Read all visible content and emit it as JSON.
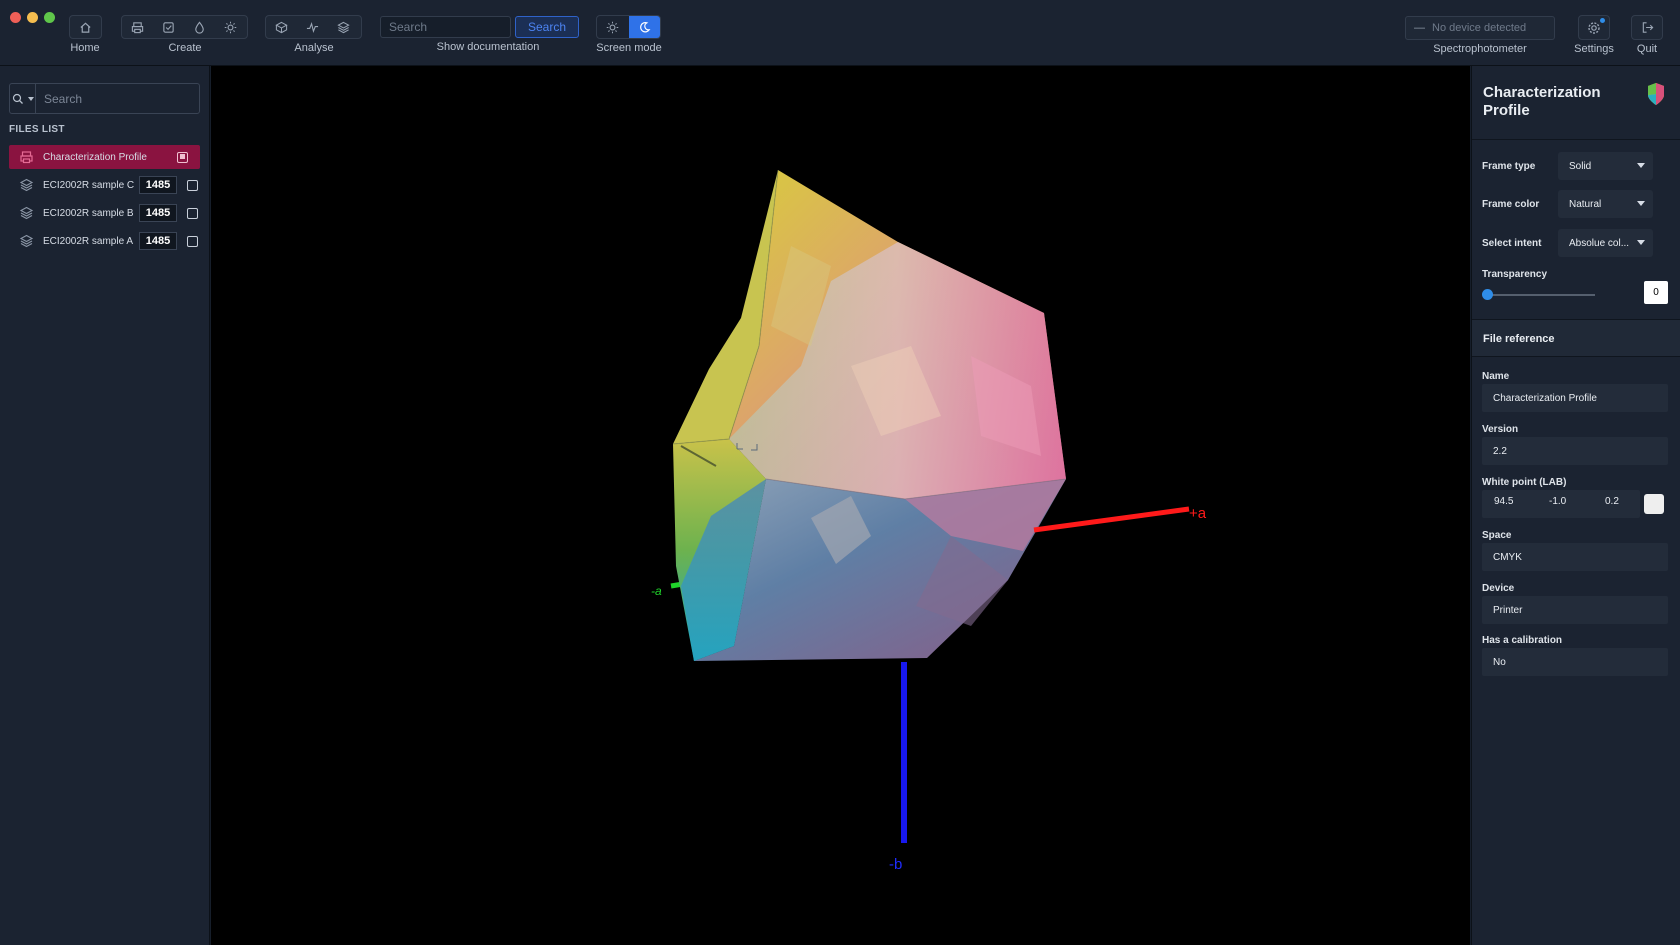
{
  "toolbar": {
    "home_label": "Home",
    "create_label": "Create",
    "analyse_label": "Analyse",
    "search_placeholder": "Search",
    "search_button": "Search",
    "show_documentation": "Show documentation",
    "screen_mode_label": "Screen mode",
    "device_status": "No device detected",
    "spectrophotometer_label": "Spectrophotometer",
    "settings_label": "Settings",
    "quit_label": "Quit"
  },
  "sidebar": {
    "search_placeholder": "Search",
    "files_title": "FILES LIST",
    "files": [
      {
        "name": "Characterization Profile",
        "count": "",
        "selected": true
      },
      {
        "name": "ECI2002R sample C",
        "count": "1485",
        "selected": false
      },
      {
        "name": "ECI2002R sample B",
        "count": "1485",
        "selected": false
      },
      {
        "name": "ECI2002R sample A",
        "count": "1485",
        "selected": false
      }
    ]
  },
  "viewport": {
    "axis_plus_a": "+a",
    "axis_minus_a": "-a",
    "axis_minus_b": "-b"
  },
  "panel": {
    "title": "Characterization Profile",
    "frame_type_label": "Frame type",
    "frame_type_value": "Solid",
    "frame_color_label": "Frame color",
    "frame_color_value": "Natural",
    "select_intent_label": "Select intent",
    "select_intent_value": "Absolue col...",
    "transparency_label": "Transparency",
    "transparency_value": "0",
    "file_reference_title": "File reference",
    "name_label": "Name",
    "name_value": "Characterization Profile",
    "version_label": "Version",
    "version_value": "2.2",
    "white_point_label": "White point (LAB)",
    "white_point_l": "94.5",
    "white_point_a": "-1.0",
    "white_point_b": "0.2",
    "space_label": "Space",
    "space_value": "CMYK",
    "device_label": "Device",
    "device_value": "Printer",
    "calibration_label": "Has a calibration",
    "calibration_value": "No"
  },
  "colors": {
    "accent": "#2f72e8",
    "selected_row": "#8a1340",
    "background": "#161e2a"
  }
}
